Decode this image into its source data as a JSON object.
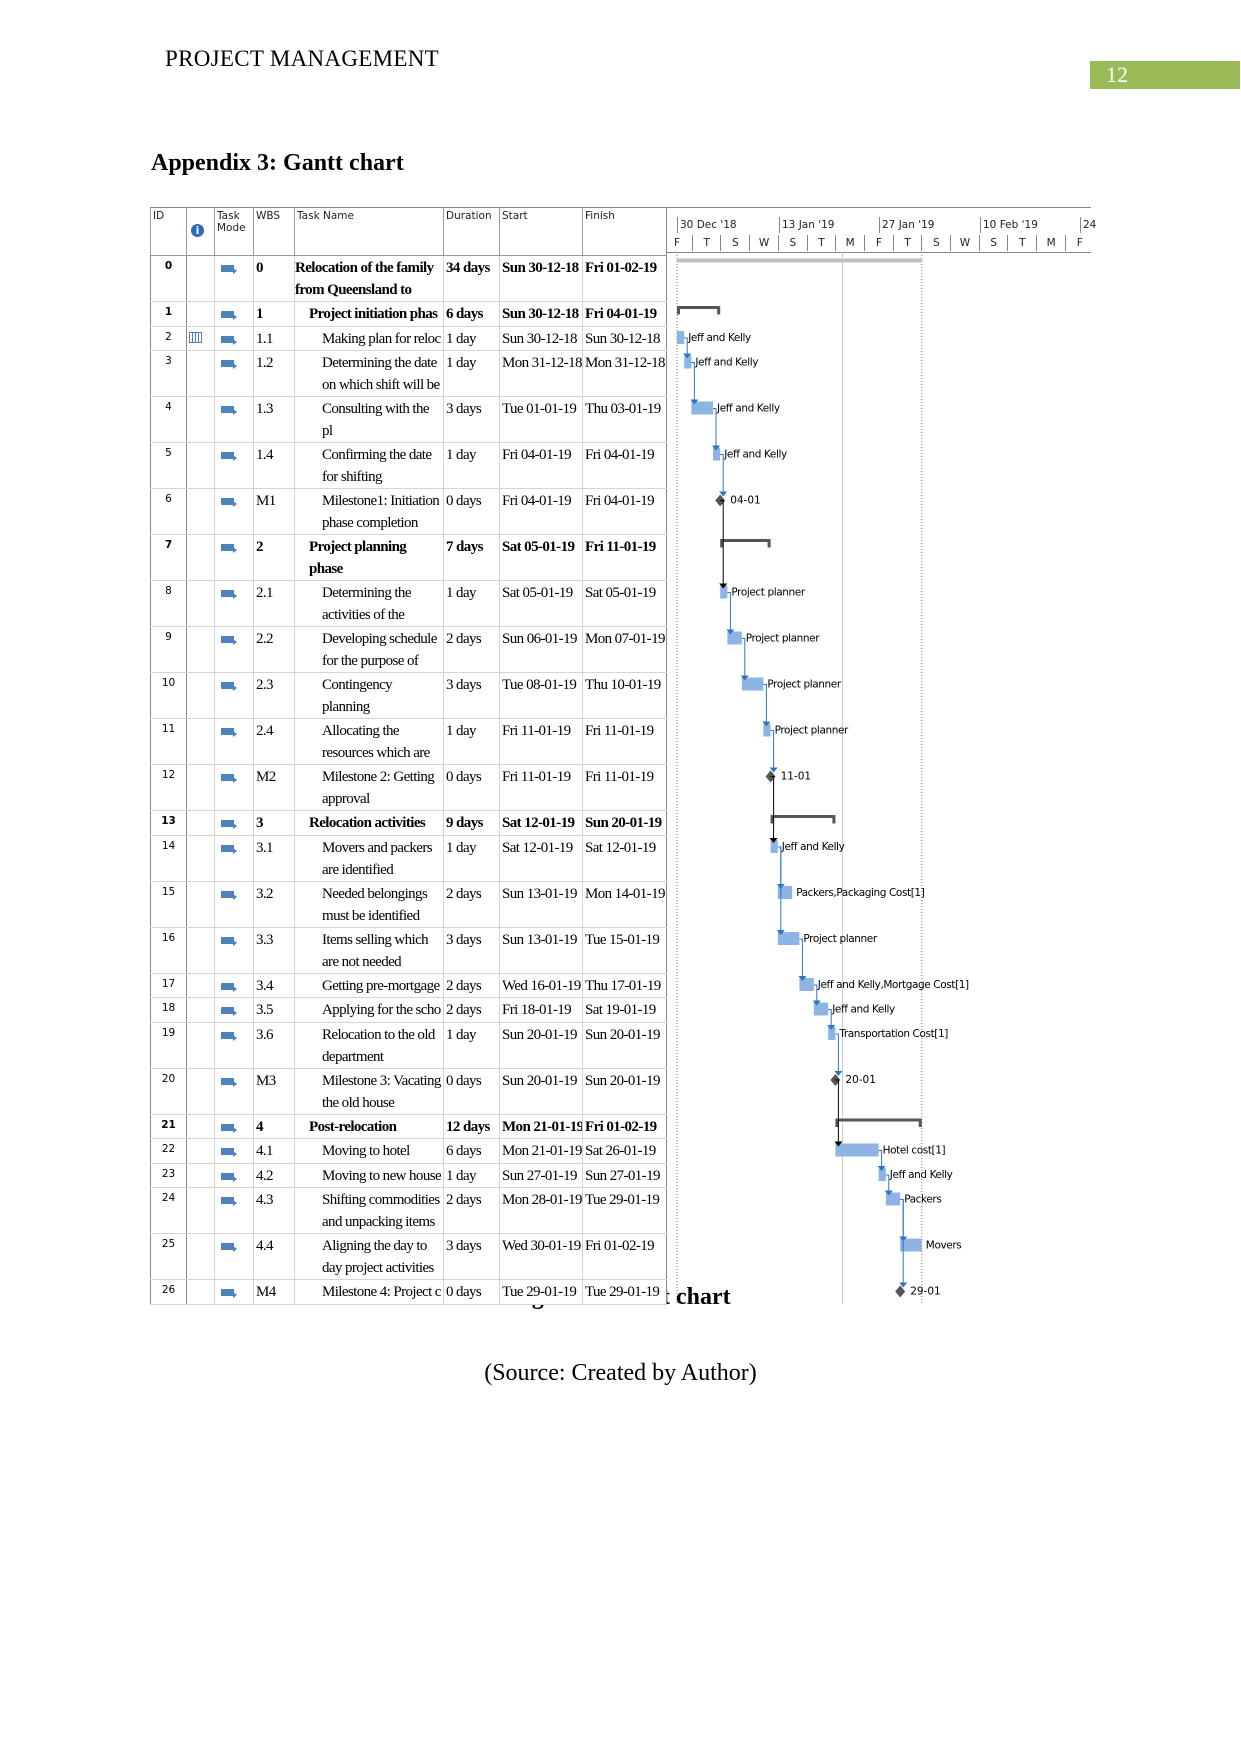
{
  "header": {
    "running_head": "PROJECT MANAGEMENT",
    "page_number": "12",
    "page_number_bg": "#9bbb59"
  },
  "appendix_title": "Appendix 3: Gantt chart",
  "columns": {
    "id": "ID",
    "task_mode_1": "Task",
    "task_mode_2": "Mode",
    "wbs": "WBS",
    "task_name": "Task Name",
    "duration": "Duration",
    "start": "Start",
    "finish": "Finish",
    "info_icon": "info-icon"
  },
  "timescale": {
    "major": [
      "30 Dec '18",
      "13 Jan '19",
      "27 Jan '19",
      "10 Feb '19",
      "24"
    ],
    "minor": [
      "F",
      "T",
      "S",
      "W",
      "S",
      "T",
      "M",
      "F",
      "T",
      "S",
      "W",
      "S",
      "T",
      "M",
      "F"
    ]
  },
  "colors": {
    "task_bar": "#8db4e2",
    "link": "#2e75c8",
    "summary": "#555555",
    "milestone": "#555555",
    "project_summary": "#bfbfbf"
  },
  "chart_data": {
    "type": "gantt",
    "start_date": "30-12-18",
    "rows": [
      {
        "id": "0",
        "wbs": "0",
        "name": "Relocation of the family from Queensland to",
        "duration": "34 days",
        "start": "Sun 30-12-18",
        "finish": "Fri 01-02-19",
        "kind": "project",
        "level": 0,
        "day": 0,
        "days": 34
      },
      {
        "id": "1",
        "wbs": "1",
        "name": "Project initiation phas",
        "duration": "6 days",
        "start": "Sun 30-12-18",
        "finish": "Fri 04-01-19",
        "kind": "summary",
        "level": 1,
        "day": 0,
        "days": 6
      },
      {
        "id": "2",
        "wbs": "1.1",
        "name": "Making plan for reloc",
        "duration": "1 day",
        "start": "Sun 30-12-18",
        "finish": "Sun 30-12-18",
        "kind": "task",
        "level": 2,
        "day": 0,
        "days": 1,
        "resource": "Jeff and Kelly",
        "indicator": "calendar-icon"
      },
      {
        "id": "3",
        "wbs": "1.2",
        "name": "Determining the date on which shift will be",
        "duration": "1 day",
        "start": "Mon 31-12-18",
        "finish": "Mon 31-12-18",
        "kind": "task",
        "level": 2,
        "day": 1,
        "days": 1,
        "resource": "Jeff and Kelly"
      },
      {
        "id": "4",
        "wbs": "1.3",
        "name": "Consulting with the pl",
        "duration": "3 days",
        "start": "Tue 01-01-19",
        "finish": "Thu 03-01-19",
        "kind": "task",
        "level": 2,
        "day": 2,
        "days": 3,
        "resource": "Jeff and Kelly"
      },
      {
        "id": "5",
        "wbs": "1.4",
        "name": "Confirming the date for shifting",
        "duration": "1 day",
        "start": "Fri 04-01-19",
        "finish": "Fri 04-01-19",
        "kind": "task",
        "level": 2,
        "day": 5,
        "days": 1,
        "resource": "Jeff and Kelly"
      },
      {
        "id": "6",
        "wbs": "M1",
        "name": "Milestone1: Initiation phase completion",
        "duration": "0 days",
        "start": "Fri 04-01-19",
        "finish": "Fri 04-01-19",
        "kind": "milestone",
        "level": 2,
        "day": 6,
        "days": 0,
        "resource": "04-01"
      },
      {
        "id": "7",
        "wbs": "2",
        "name": "Project planning phase",
        "duration": "7 days",
        "start": "Sat 05-01-19",
        "finish": "Fri 11-01-19",
        "kind": "summary",
        "level": 1,
        "day": 6,
        "days": 7
      },
      {
        "id": "8",
        "wbs": "2.1",
        "name": "Determining the activities of the",
        "duration": "1 day",
        "start": "Sat 05-01-19",
        "finish": "Sat 05-01-19",
        "kind": "task",
        "level": 2,
        "day": 6,
        "days": 1,
        "resource": "Project planner"
      },
      {
        "id": "9",
        "wbs": "2.2",
        "name": "Developing schedule for the purpose of",
        "duration": "2 days",
        "start": "Sun 06-01-19",
        "finish": "Mon 07-01-19",
        "kind": "task",
        "level": 2,
        "day": 7,
        "days": 2,
        "resource": "Project planner"
      },
      {
        "id": "10",
        "wbs": "2.3",
        "name": "Contingency planning",
        "duration": "3 days",
        "start": "Tue 08-01-19",
        "finish": "Thu 10-01-19",
        "kind": "task",
        "level": 2,
        "day": 9,
        "days": 3,
        "resource": "Project planner"
      },
      {
        "id": "11",
        "wbs": "2.4",
        "name": "Allocating the resources which are",
        "duration": "1 day",
        "start": "Fri 11-01-19",
        "finish": "Fri 11-01-19",
        "kind": "task",
        "level": 2,
        "day": 12,
        "days": 1,
        "resource": "Project planner"
      },
      {
        "id": "12",
        "wbs": "M2",
        "name": "Milestone 2: Getting approval",
        "duration": "0 days",
        "start": "Fri 11-01-19",
        "finish": "Fri 11-01-19",
        "kind": "milestone",
        "level": 2,
        "day": 13,
        "days": 0,
        "resource": "11-01"
      },
      {
        "id": "13",
        "wbs": "3",
        "name": "Relocation activities",
        "duration": "9 days",
        "start": "Sat 12-01-19",
        "finish": "Sun 20-01-19",
        "kind": "summary",
        "level": 1,
        "day": 13,
        "days": 9
      },
      {
        "id": "14",
        "wbs": "3.1",
        "name": "Movers and packers are identified",
        "duration": "1 day",
        "start": "Sat 12-01-19",
        "finish": "Sat 12-01-19",
        "kind": "task",
        "level": 2,
        "day": 13,
        "days": 1,
        "resource": "Jeff and Kelly"
      },
      {
        "id": "15",
        "wbs": "3.2",
        "name": "Needed belongings must be identified",
        "duration": "2 days",
        "start": "Sun 13-01-19",
        "finish": "Mon 14-01-19",
        "kind": "task",
        "level": 2,
        "day": 14,
        "days": 2,
        "resource": "Packers,Packaging Cost[1]"
      },
      {
        "id": "16",
        "wbs": "3.3",
        "name": "Items selling which are not needed",
        "duration": "3 days",
        "start": "Sun 13-01-19",
        "finish": "Tue 15-01-19",
        "kind": "task",
        "level": 2,
        "day": 14,
        "days": 3,
        "resource": "Project planner"
      },
      {
        "id": "17",
        "wbs": "3.4",
        "name": "Getting pre-mortgage",
        "duration": "2 days",
        "start": "Wed 16-01-19",
        "finish": "Thu 17-01-19",
        "kind": "task",
        "level": 2,
        "day": 17,
        "days": 2,
        "resource": "Jeff and Kelly,Mortgage Cost[1]"
      },
      {
        "id": "18",
        "wbs": "3.5",
        "name": "Applying for the scho",
        "duration": "2 days",
        "start": "Fri 18-01-19",
        "finish": "Sat 19-01-19",
        "kind": "task",
        "level": 2,
        "day": 19,
        "days": 2,
        "resource": "Jeff and Kelly"
      },
      {
        "id": "19",
        "wbs": "3.6",
        "name": "Relocation to the old department",
        "duration": "1 day",
        "start": "Sun 20-01-19",
        "finish": "Sun 20-01-19",
        "kind": "task",
        "level": 2,
        "day": 21,
        "days": 1,
        "resource": "Transportation Cost[1]"
      },
      {
        "id": "20",
        "wbs": "M3",
        "name": "Milestone 3: Vacating the old house",
        "duration": "0 days",
        "start": "Sun 20-01-19",
        "finish": "Sun 20-01-19",
        "kind": "milestone",
        "level": 2,
        "day": 22,
        "days": 0,
        "resource": "20-01"
      },
      {
        "id": "21",
        "wbs": "4",
        "name": "Post-relocation",
        "duration": "12 days",
        "start": "Mon 21-01-19",
        "finish": "Fri 01-02-19",
        "kind": "summary",
        "level": 1,
        "day": 22,
        "days": 12
      },
      {
        "id": "22",
        "wbs": "4.1",
        "name": "Moving to hotel",
        "duration": "6 days",
        "start": "Mon 21-01-19",
        "finish": "Sat 26-01-19",
        "kind": "task",
        "level": 2,
        "day": 22,
        "days": 6,
        "resource": "Hotel cost[1]"
      },
      {
        "id": "23",
        "wbs": "4.2",
        "name": "Moving to new house",
        "duration": "1 day",
        "start": "Sun 27-01-19",
        "finish": "Sun 27-01-19",
        "kind": "task",
        "level": 2,
        "day": 28,
        "days": 1,
        "resource": "Jeff and Kelly"
      },
      {
        "id": "24",
        "wbs": "4.3",
        "name": "Shifting commodities and unpacking items",
        "duration": "2 days",
        "start": "Mon 28-01-19",
        "finish": "Tue 29-01-19",
        "kind": "task",
        "level": 2,
        "day": 29,
        "days": 2,
        "resource": "Packers"
      },
      {
        "id": "25",
        "wbs": "4.4",
        "name": "Aligning the day to day project activities",
        "duration": "3 days",
        "start": "Wed 30-01-19",
        "finish": "Fri 01-02-19",
        "kind": "task",
        "level": 2,
        "day": 31,
        "days": 3,
        "resource": "Movers"
      },
      {
        "id": "26",
        "wbs": "M4",
        "name": "Milestone 4: Project c",
        "duration": "0 days",
        "start": "Tue 29-01-19",
        "finish": "Tue 29-01-19",
        "kind": "milestone",
        "level": 2,
        "day": 31,
        "days": 0,
        "resource": "29-01"
      }
    ],
    "links": [
      [
        2,
        3
      ],
      [
        3,
        4
      ],
      [
        4,
        5
      ],
      [
        5,
        6
      ],
      [
        6,
        8
      ],
      [
        8,
        9
      ],
      [
        9,
        10
      ],
      [
        10,
        11
      ],
      [
        11,
        12
      ],
      [
        12,
        14
      ],
      [
        14,
        15
      ],
      [
        14,
        16
      ],
      [
        16,
        17
      ],
      [
        17,
        18
      ],
      [
        18,
        19
      ],
      [
        19,
        20
      ],
      [
        20,
        22
      ],
      [
        22,
        23
      ],
      [
        23,
        24
      ],
      [
        24,
        25
      ],
      [
        24,
        26
      ]
    ]
  },
  "caption": "Figure 2: Gantt chart",
  "source": "(Source: Created by Author)"
}
